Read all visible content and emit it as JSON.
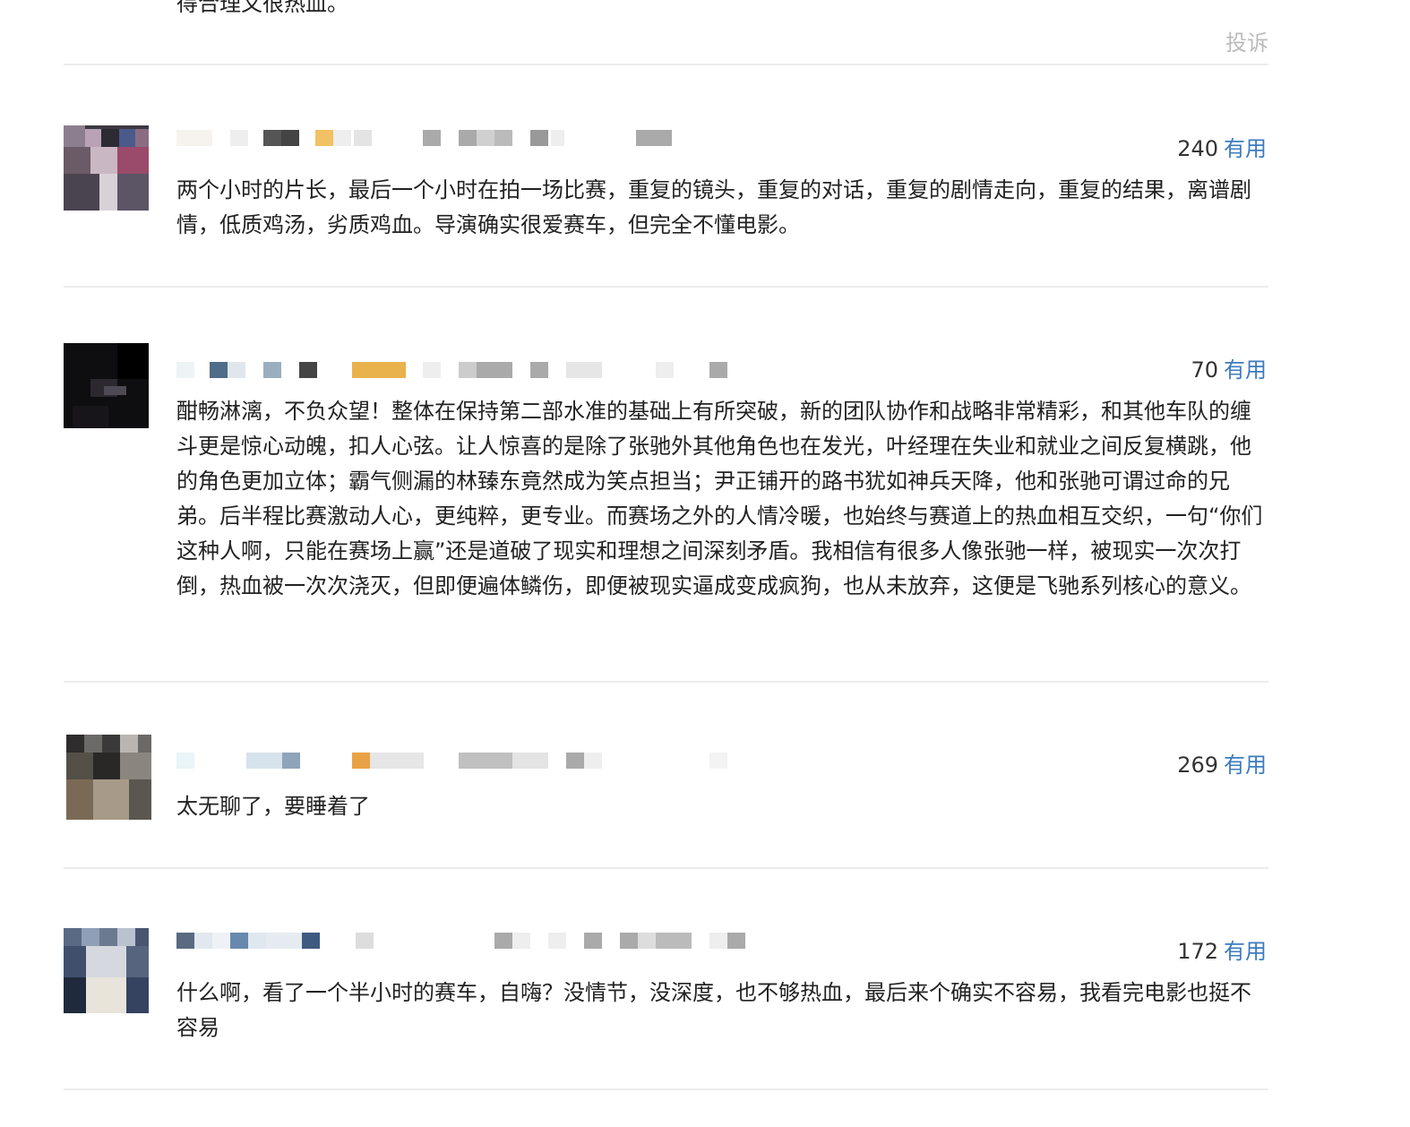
{
  "top": {
    "text_tail": "得合理又很热血。",
    "complain_label": "投诉"
  },
  "comments": [
    {
      "votes": "240",
      "useful_label": "有用",
      "text": "两个小时的片长，最后一个小时在拍一场比赛，重复的镜头，重复的对话，重复的剧情走向，重复的结果，离谱剧情，低质鸡汤，劣质鸡血。导演确实很爱赛车，但完全不懂电影。"
    },
    {
      "votes": "70",
      "useful_label": "有用",
      "text": "酣畅淋漓，不负众望！整体在保持第二部水准的基础上有所突破，新的团队协作和战略非常精彩，和其他车队的缠斗更是惊心动魄，扣人心弦。让人惊喜的是除了张驰外其他角色也在发光，叶经理在失业和就业之间反复横跳，他的角色更加立体；霸气侧漏的林臻东竟然成为笑点担当；尹正铺开的路书犹如神兵天降，他和张驰可谓过命的兄弟。后半程比赛激动人心，更纯粹，更专业。而赛场之外的人情冷暖，也始终与赛道上的热血相互交织，一句“你们这种人啊，只能在赛场上赢”还是道破了现实和理想之间深刻矛盾。我相信有很多人像张驰一样，被现实一次次打倒，热血被一次次浇灭，但即便遍体鳞伤，即便被现实逼成变成疯狗，也从未放弃，这便是飞驰系列核心的意义。"
    },
    {
      "votes": "269",
      "useful_label": "有用",
      "text": "太无聊了，要睡着了"
    },
    {
      "votes": "172",
      "useful_label": "有用",
      "text": "什么啊，看了一个半小时的赛车，自嗨？没情节，没深度，也不够热血，最后来个确实不容易，我看完电影也挺不容易"
    }
  ],
  "colors": {
    "useful_link": "#3d7bbf",
    "complain": "#bbbbbb",
    "divider": "#ececec"
  }
}
